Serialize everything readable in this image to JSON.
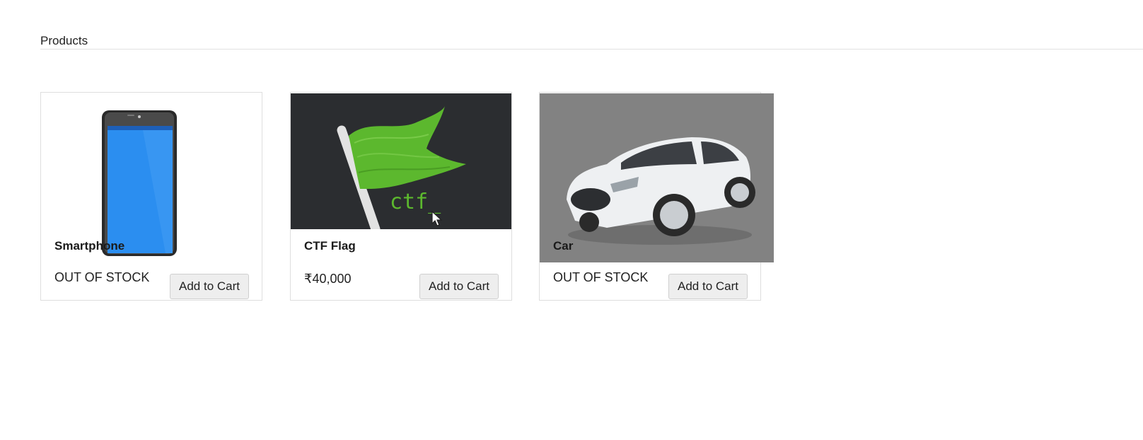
{
  "section": {
    "title": "Products"
  },
  "products": [
    {
      "name": "Smartphone",
      "price_text": "OUT OF STOCK",
      "button_label": "Add to Cart",
      "image_icon": "smartphone-image"
    },
    {
      "name": "CTF Flag",
      "price_text": "₹40,000",
      "button_label": "Add to Cart",
      "image_icon": "ctf-flag-image",
      "image_text": "ctf_"
    },
    {
      "name": "Car",
      "price_text": "OUT OF STOCK",
      "button_label": "Add to Cart",
      "image_icon": "car-image"
    }
  ],
  "colors": {
    "flag_bg": "#2b2d30",
    "flag_green": "#5cb82e",
    "car_bg": "#828282",
    "phone_screen": "#2b8ef0",
    "button_bg": "#eeeeee"
  }
}
